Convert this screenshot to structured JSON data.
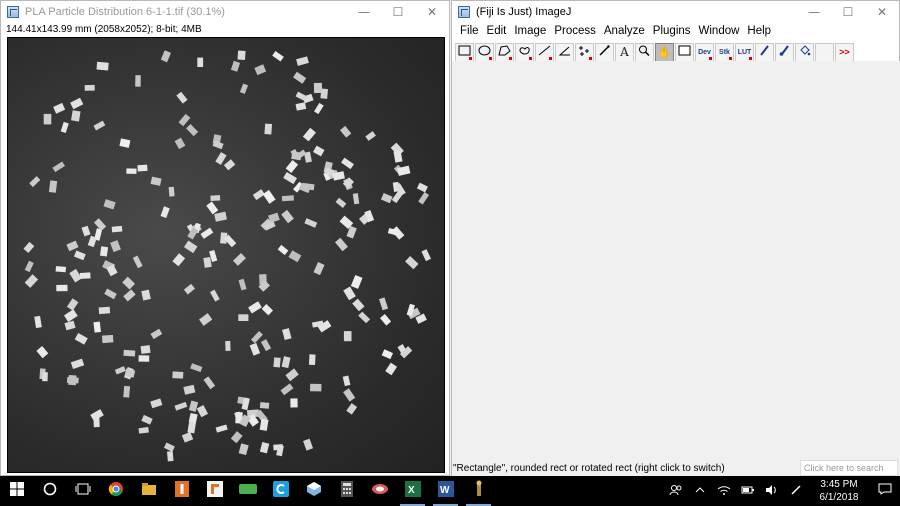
{
  "image_window": {
    "title": "PLA Particle Distribution 6-1-1.tif (30.1%)",
    "info": "144.41x143.99 mm (2058x2052); 8-bit; 4MB",
    "controls": [
      "minimize-icon",
      "maximize-icon",
      "close-icon"
    ]
  },
  "imagej_window": {
    "title": "(Fiji Is Just) ImageJ",
    "menu": [
      "File",
      "Edit",
      "Image",
      "Process",
      "Analyze",
      "Plugins",
      "Window",
      "Help"
    ],
    "tools": [
      {
        "icon": "rectangle-icon"
      },
      {
        "icon": "oval-icon"
      },
      {
        "icon": "polygon-icon"
      },
      {
        "icon": "freehand-icon"
      },
      {
        "icon": "line-icon"
      },
      {
        "icon": "angle-icon"
      },
      {
        "icon": "multipoint-icon"
      },
      {
        "icon": "wand-icon"
      },
      {
        "icon": "text-icon"
      },
      {
        "icon": "magnifier-icon"
      },
      {
        "icon": "hand-icon",
        "selected": true
      },
      {
        "icon": "color-picker-icon"
      },
      {
        "label": "Dev"
      },
      {
        "label": "Stk"
      },
      {
        "label": "LUT"
      },
      {
        "icon": "pencil-icon"
      },
      {
        "icon": "brush-icon"
      },
      {
        "icon": "flood-fill-icon"
      },
      {
        "icon": "blank-icon"
      },
      {
        "label": ">>"
      }
    ],
    "status": "\"Rectangle\", rounded rect or rotated rect (right click to switch)"
  },
  "search": {
    "placeholder": "Click here to search"
  },
  "taskbar": {
    "apps": [
      "start-icon",
      "cortana-icon",
      "task-view-icon",
      "chrome-icon",
      "file-explorer-icon",
      "imagej-icon",
      "fiji-icon",
      "app-icon",
      "cortana-c-icon",
      "app-cube-icon",
      "calculator-icon",
      "browser-icon",
      "excel-icon",
      "word-icon",
      "fiji-taskbar-icon"
    ],
    "time": "3:45 PM",
    "date": "6/1/2018"
  }
}
